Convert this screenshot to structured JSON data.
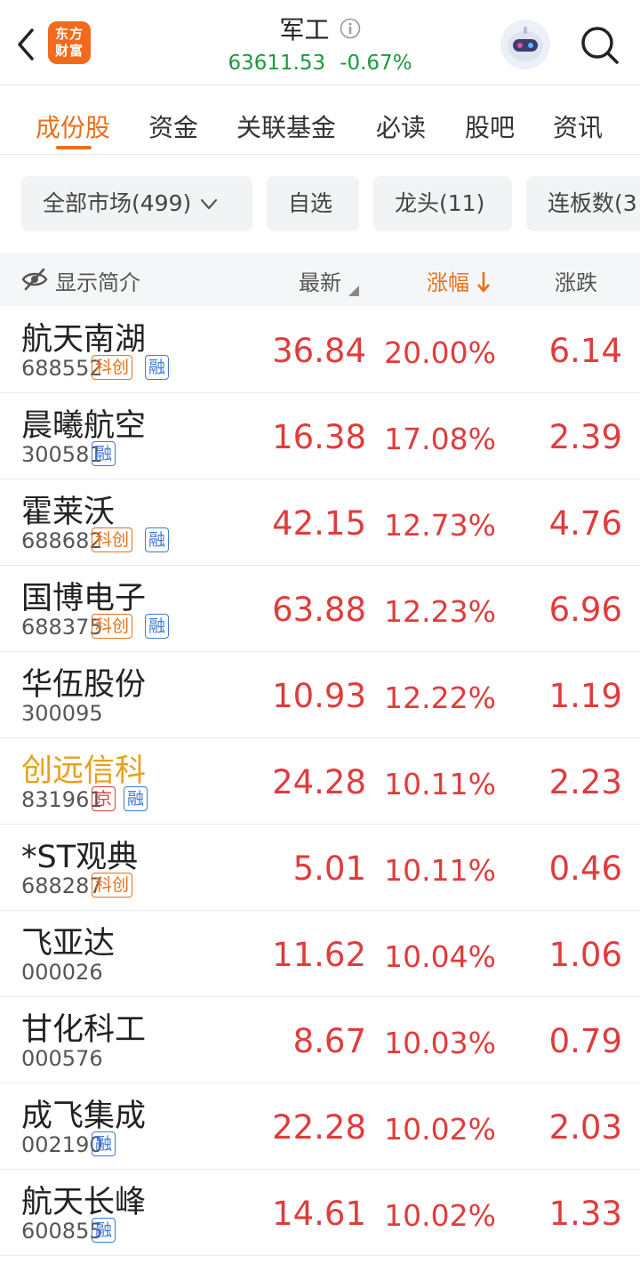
{
  "header": {
    "title": "军工",
    "index_value": "63611.53",
    "index_change": "-0.67%",
    "logo_line1": "东方",
    "logo_line2": "财富"
  },
  "tabs": [
    {
      "label": "成份股",
      "active": true
    },
    {
      "label": "资金"
    },
    {
      "label": "关联基金"
    },
    {
      "label": "必读"
    },
    {
      "label": "股吧"
    },
    {
      "label": "资讯"
    }
  ],
  "filters": [
    {
      "label": "全部市场(499)",
      "has_dropdown": true
    },
    {
      "label": "自选"
    },
    {
      "label": "龙头(11)"
    },
    {
      "label": "连板数(3"
    }
  ],
  "columns": {
    "toggle_label": "显示简介",
    "price": "最新",
    "pct": "涨幅",
    "change": "涨跌"
  },
  "colors": {
    "accent": "#e8701a",
    "up": "#e03c3c",
    "down": "#1a9a3c",
    "tag_margin": "#3f7bd6"
  },
  "rows": [
    {
      "name": "航天南湖",
      "code": "688552",
      "tags": [
        "科创",
        "融"
      ],
      "price": "36.84",
      "pct": "20.00%",
      "change": "6.14"
    },
    {
      "name": "晨曦航空",
      "code": "300581",
      "tags": [
        "融"
      ],
      "price": "16.38",
      "pct": "17.08%",
      "change": "2.39"
    },
    {
      "name": "霍莱沃",
      "code": "688682",
      "tags": [
        "科创",
        "融"
      ],
      "price": "42.15",
      "pct": "12.73%",
      "change": "4.76"
    },
    {
      "name": "国博电子",
      "code": "688375",
      "tags": [
        "科创",
        "融"
      ],
      "price": "63.88",
      "pct": "12.23%",
      "change": "6.96"
    },
    {
      "name": "华伍股份",
      "code": "300095",
      "tags": [],
      "price": "10.93",
      "pct": "12.22%",
      "change": "1.19"
    },
    {
      "name": "创远信科",
      "code": "831961",
      "tags": [
        "京",
        "融"
      ],
      "price": "24.28",
      "pct": "10.11%",
      "change": "2.23",
      "highlight": true
    },
    {
      "name": "*ST观典",
      "code": "688287",
      "tags": [
        "科创"
      ],
      "price": "5.01",
      "pct": "10.11%",
      "change": "0.46"
    },
    {
      "name": "飞亚达",
      "code": "000026",
      "tags": [],
      "price": "11.62",
      "pct": "10.04%",
      "change": "1.06"
    },
    {
      "name": "甘化科工",
      "code": "000576",
      "tags": [],
      "price": "8.67",
      "pct": "10.03%",
      "change": "0.79"
    },
    {
      "name": "成飞集成",
      "code": "002190",
      "tags": [
        "融"
      ],
      "price": "22.28",
      "pct": "10.02%",
      "change": "2.03"
    },
    {
      "name": "航天长峰",
      "code": "600855",
      "tags": [
        "融"
      ],
      "price": "14.61",
      "pct": "10.02%",
      "change": "1.33"
    }
  ]
}
